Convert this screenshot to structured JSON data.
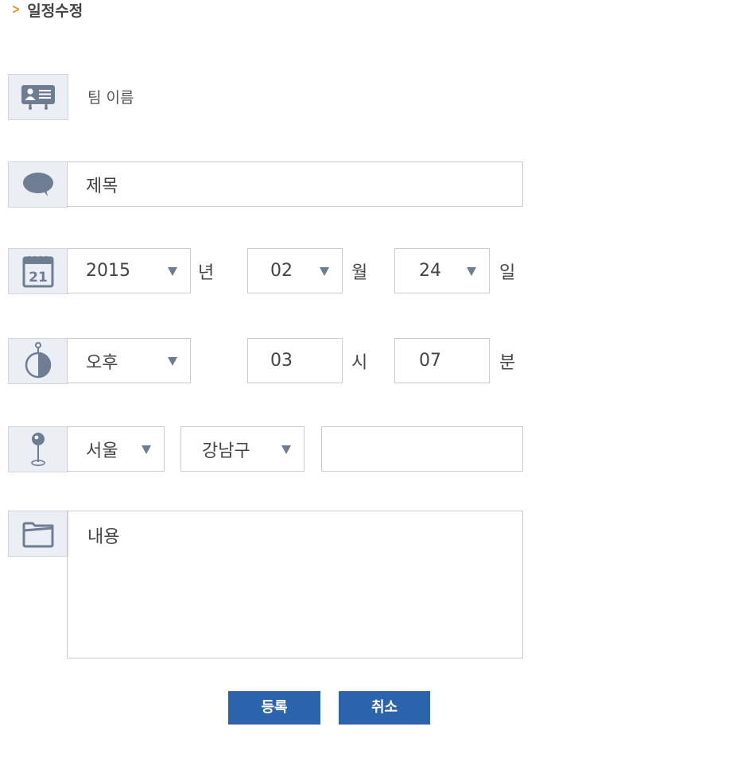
{
  "page": {
    "title": "일정수정"
  },
  "form": {
    "team_name": "팀 이름",
    "subject_placeholder": "제목",
    "date": {
      "year": "2015",
      "year_unit": "년",
      "month": "02",
      "month_unit": "월",
      "day": "24",
      "day_unit": "일"
    },
    "time": {
      "ampm": "오후",
      "hour": "03",
      "hour_unit": "시",
      "minute": "07",
      "minute_unit": "분"
    },
    "location": {
      "city": "서울",
      "district": "강남구",
      "detail": ""
    },
    "content_placeholder": "내용"
  },
  "buttons": {
    "register": "등록",
    "cancel": "취소"
  },
  "icons": {
    "team": "id-card-icon",
    "subject": "speech-bubble-icon",
    "date": "calendar-icon",
    "time": "stopwatch-icon",
    "location": "map-pin-icon",
    "content": "folder-icon"
  },
  "colors": {
    "accent": "#f0912b",
    "button": "#2b63ad",
    "icon": "#6f7d93",
    "icon_bg": "#ebeff5"
  }
}
